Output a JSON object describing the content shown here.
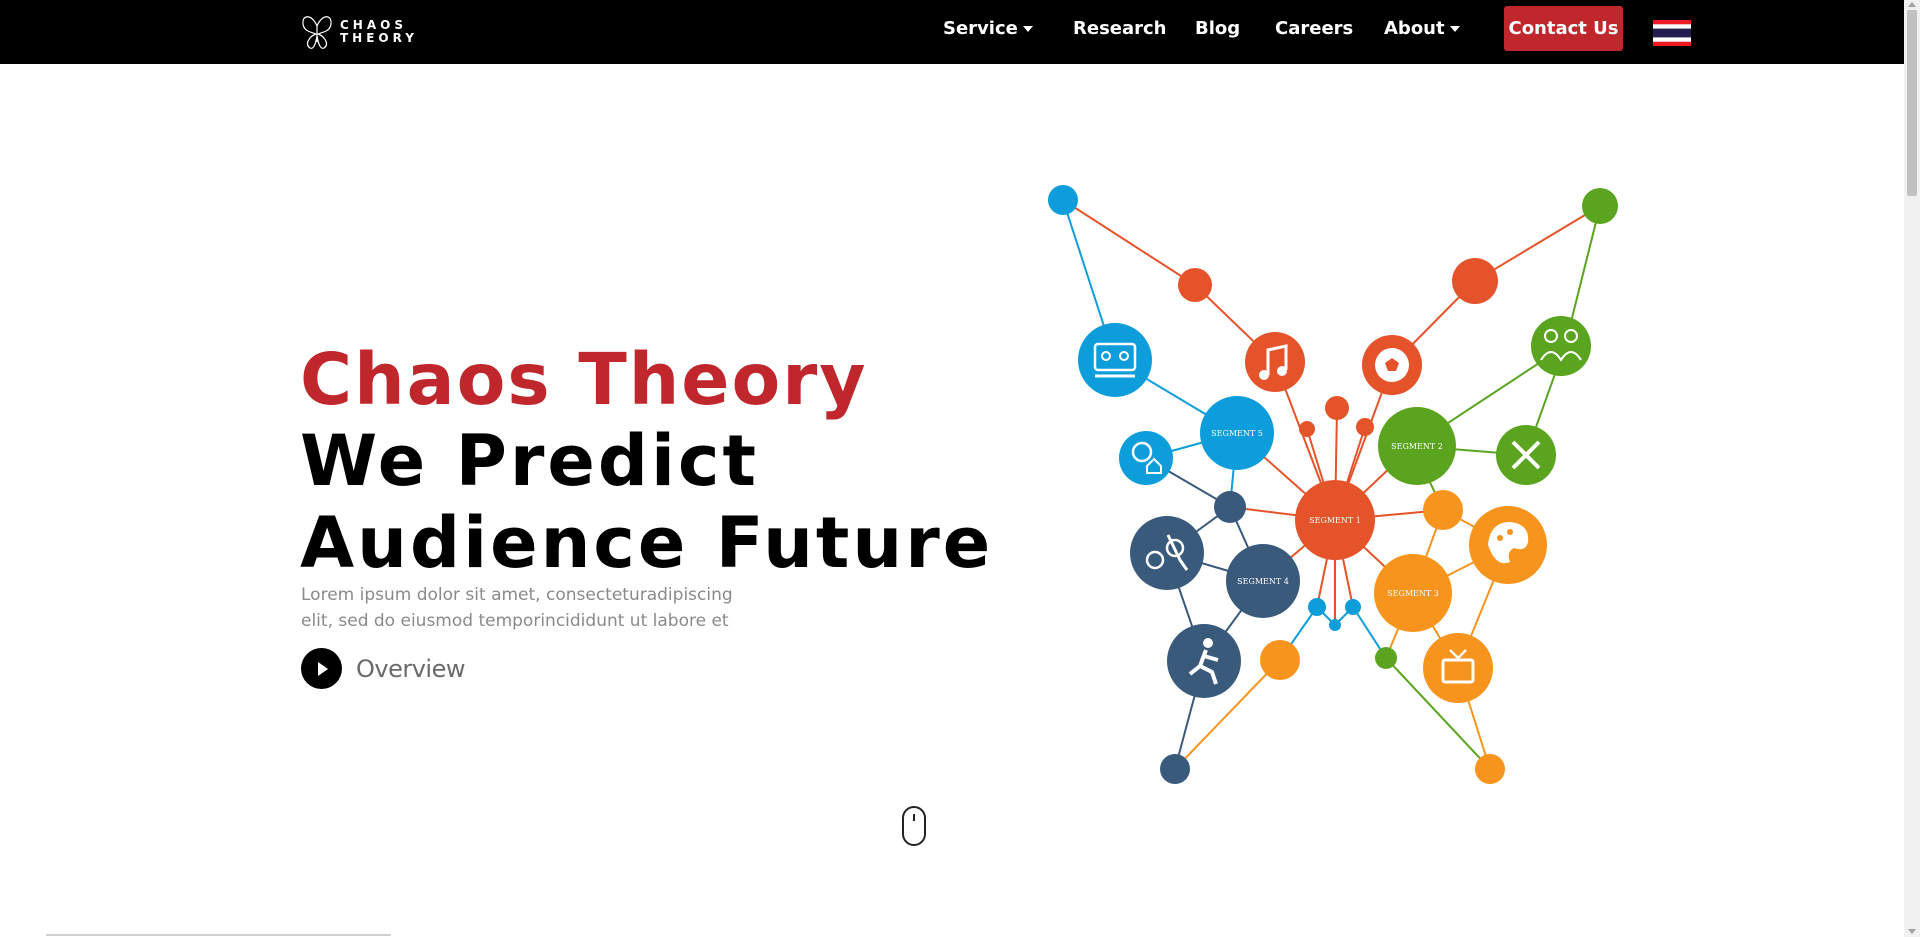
{
  "nav": {
    "logo_line1": "CHAOS",
    "logo_line2": "THEORY",
    "items": [
      {
        "label": "Service",
        "has_dropdown": true
      },
      {
        "label": "Research",
        "has_dropdown": false
      },
      {
        "label": "Blog",
        "has_dropdown": false
      },
      {
        "label": "Careers",
        "has_dropdown": false
      },
      {
        "label": "About",
        "has_dropdown": true
      }
    ],
    "contact_label": "Contact Us",
    "language_icon": "thai-flag-icon"
  },
  "hero": {
    "title_red": "Chaos Theory",
    "title_line2": "We Predict",
    "title_line3": "Audience Future",
    "subtitle": "Lorem ipsum dolor sit amet, consecteturadipiscing elit, sed do eiusmod temporincididunt ut labore et",
    "overview_label": "Overview"
  },
  "graphic": {
    "segments": [
      "SEGMENT 1",
      "SEGMENT 2",
      "SEGMENT 3",
      "SEGMENT 4",
      "SEGMENT 5"
    ],
    "icons": [
      "bed-icon",
      "music-note-icon",
      "soccer-ball-icon",
      "family-icon",
      "location-home-icon",
      "utensils-icon",
      "cycling-icon",
      "palette-icon",
      "runner-icon",
      "tv-icon"
    ]
  },
  "colors": {
    "nav_bg": "#000000",
    "brand_red": "#c0272d",
    "orange_red": "#e5532a",
    "blue": "#0d9ddb",
    "green": "#5aa41f",
    "orange": "#f7941d",
    "navy": "#3a5a7c"
  },
  "scroll_indicator_icon": "mouse-icon"
}
